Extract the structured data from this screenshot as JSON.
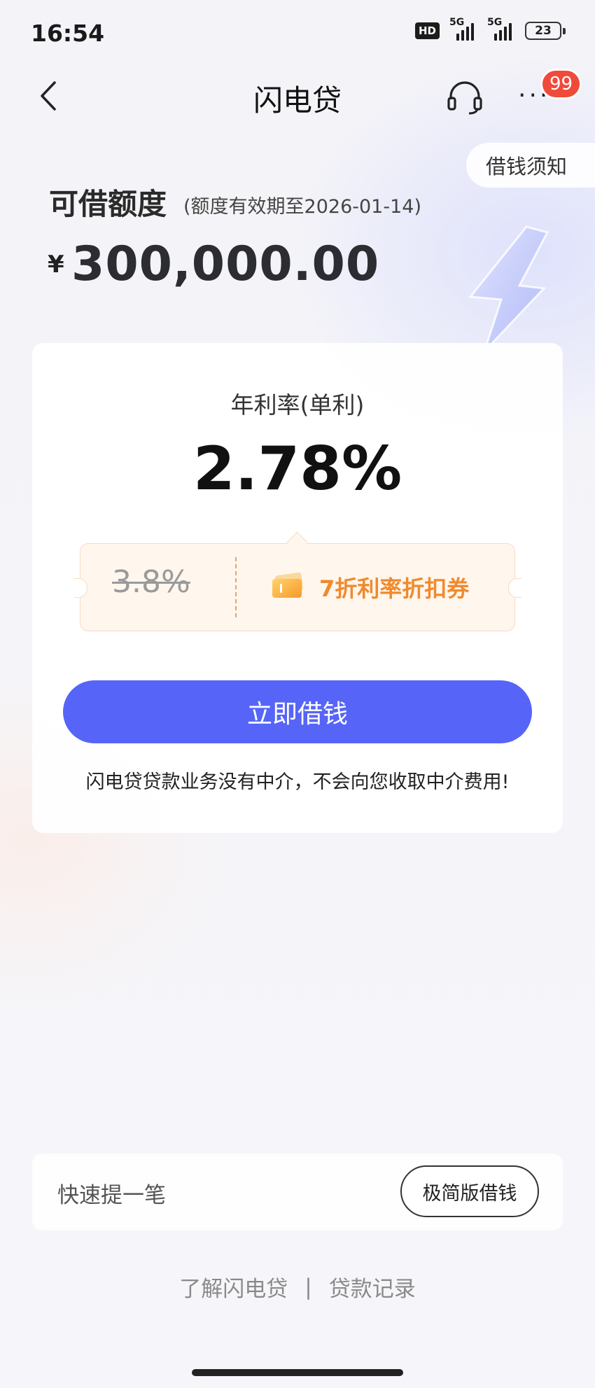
{
  "status_bar": {
    "time": "16:54",
    "hd_label": "HD",
    "network_1": "5G",
    "network_2": "5G",
    "battery": "23"
  },
  "nav": {
    "title": "闪电贷",
    "more_label": "···",
    "badge_count": "99"
  },
  "notice": {
    "label": "借钱须知"
  },
  "credit": {
    "title": "可借额度",
    "validity": "(额度有效期至2026-01-14)",
    "currency_symbol": "¥",
    "amount": "300,000.00"
  },
  "rate": {
    "label": "年利率(单利)",
    "value": "2.78%"
  },
  "coupon": {
    "original_rate": "3.8%",
    "text": "7折利率折扣券"
  },
  "actions": {
    "borrow_now": "立即借钱"
  },
  "disclaimer": "闪电贷贷款业务没有中介，不会向您收取中介费用!",
  "quick": {
    "label": "快速提一笔",
    "button": "极简版借钱"
  },
  "footer": {
    "link_about": "了解闪电贷",
    "separator": "|",
    "link_records": "贷款记录"
  },
  "colors": {
    "primary_button": "#5665f7",
    "coupon_accent": "#f08a2c",
    "badge": "#f04a3b"
  }
}
